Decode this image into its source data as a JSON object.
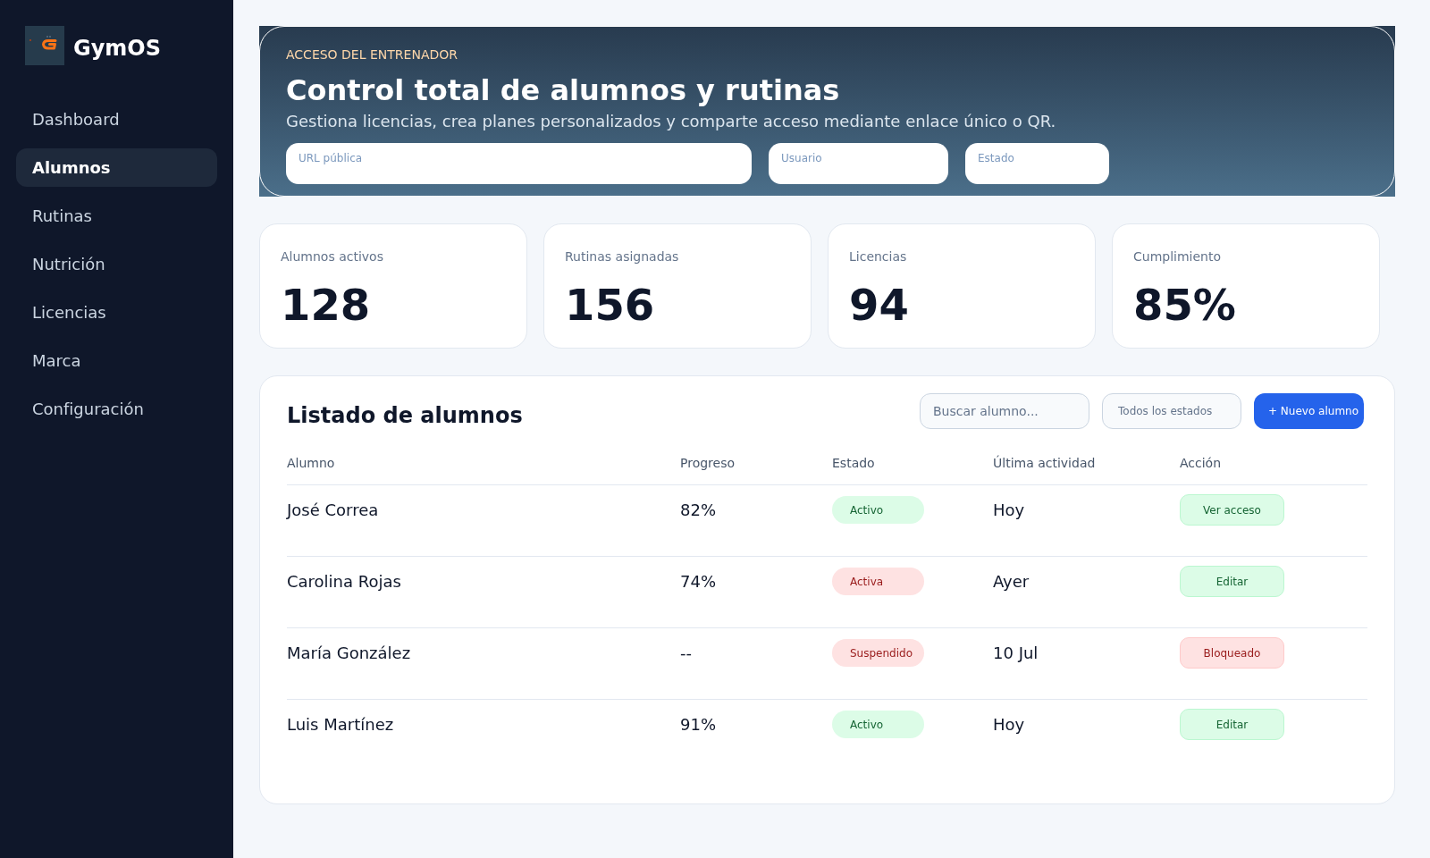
{
  "sidebar": {
    "brand": "GymOS",
    "items": [
      {
        "label": "Dashboard",
        "selected": false
      },
      {
        "label": "Alumnos",
        "selected": true
      },
      {
        "label": "Rutinas",
        "selected": false
      },
      {
        "label": "Nutrición",
        "selected": false
      },
      {
        "label": "Licencias",
        "selected": false
      },
      {
        "label": "Marca",
        "selected": false
      },
      {
        "label": "Configuración",
        "selected": false
      }
    ]
  },
  "hero": {
    "eyebrow": "ACCESO DEL ENTRENADOR",
    "title": "Control total de alumnos y rutinas",
    "subtitle": "Gestiona licencias, crea planes personalizados y comparte acceso mediante enlace único o QR.",
    "fields": [
      {
        "placeholder": "URL pública"
      },
      {
        "placeholder": "Usuario"
      },
      {
        "placeholder": "Estado"
      }
    ]
  },
  "stats": [
    {
      "label": "Alumnos activos",
      "value": "128"
    },
    {
      "label": "Rutinas asignadas",
      "value": "156"
    },
    {
      "label": "Licencias",
      "value": "94"
    },
    {
      "label": "Cumplimiento",
      "value": "85%"
    }
  ],
  "students_panel": {
    "title": "Listado de alumnos",
    "search": {
      "placeholder": "Buscar alumno..."
    },
    "status_filter": {
      "value": "Todos los estados"
    },
    "new_button": {
      "label": "+ Nuevo alumno"
    },
    "columns": [
      "Alumno",
      "Progreso",
      "Estado",
      "Última actividad",
      "Acción"
    ],
    "rows": [
      {
        "name": "José Correa",
        "progress": "82%",
        "status": {
          "label": "Activo",
          "color": "#166534"
        },
        "last_activity": "Hoy",
        "action": {
          "label": "Ver acceso",
          "color": "#166534"
        }
      },
      {
        "name": "Carolina Rojas",
        "progress": "74%",
        "status": {
          "label": "Activa",
          "color": "#991b1b"
        },
        "last_activity": "Ayer",
        "action": {
          "label": "Editar",
          "color": "#166534"
        }
      },
      {
        "name": "María González",
        "progress": "--",
        "status": {
          "label": "Suspendido",
          "color": "#991b1b"
        },
        "last_activity": "10 Jul",
        "action": {
          "label": "Bloqueado",
          "color": "#991b1b"
        }
      },
      {
        "name": "Luis Martínez",
        "progress": "91%",
        "status": {
          "label": "Activo",
          "color": "#166534"
        },
        "last_activity": "Hoy",
        "action": {
          "label": "Editar",
          "color": "#166534"
        }
      }
    ]
  }
}
